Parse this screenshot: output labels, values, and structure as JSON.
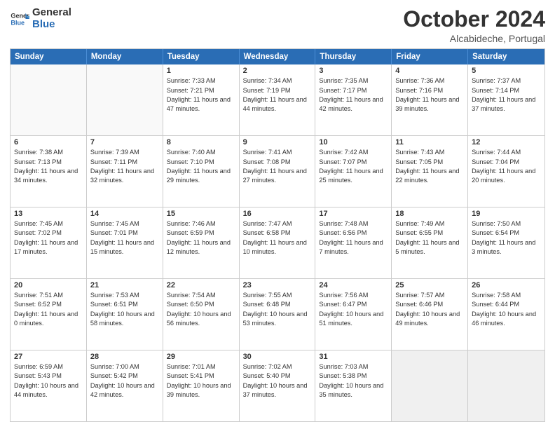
{
  "header": {
    "logo_general": "General",
    "logo_blue": "Blue",
    "month": "October 2024",
    "location": "Alcabideche, Portugal"
  },
  "days_of_week": [
    "Sunday",
    "Monday",
    "Tuesday",
    "Wednesday",
    "Thursday",
    "Friday",
    "Saturday"
  ],
  "rows": [
    [
      {
        "day": "",
        "empty": true
      },
      {
        "day": "",
        "empty": true
      },
      {
        "day": "1",
        "sunrise": "Sunrise: 7:33 AM",
        "sunset": "Sunset: 7:21 PM",
        "daylight": "Daylight: 11 hours and 47 minutes."
      },
      {
        "day": "2",
        "sunrise": "Sunrise: 7:34 AM",
        "sunset": "Sunset: 7:19 PM",
        "daylight": "Daylight: 11 hours and 44 minutes."
      },
      {
        "day": "3",
        "sunrise": "Sunrise: 7:35 AM",
        "sunset": "Sunset: 7:17 PM",
        "daylight": "Daylight: 11 hours and 42 minutes."
      },
      {
        "day": "4",
        "sunrise": "Sunrise: 7:36 AM",
        "sunset": "Sunset: 7:16 PM",
        "daylight": "Daylight: 11 hours and 39 minutes."
      },
      {
        "day": "5",
        "sunrise": "Sunrise: 7:37 AM",
        "sunset": "Sunset: 7:14 PM",
        "daylight": "Daylight: 11 hours and 37 minutes."
      }
    ],
    [
      {
        "day": "6",
        "sunrise": "Sunrise: 7:38 AM",
        "sunset": "Sunset: 7:13 PM",
        "daylight": "Daylight: 11 hours and 34 minutes."
      },
      {
        "day": "7",
        "sunrise": "Sunrise: 7:39 AM",
        "sunset": "Sunset: 7:11 PM",
        "daylight": "Daylight: 11 hours and 32 minutes."
      },
      {
        "day": "8",
        "sunrise": "Sunrise: 7:40 AM",
        "sunset": "Sunset: 7:10 PM",
        "daylight": "Daylight: 11 hours and 29 minutes."
      },
      {
        "day": "9",
        "sunrise": "Sunrise: 7:41 AM",
        "sunset": "Sunset: 7:08 PM",
        "daylight": "Daylight: 11 hours and 27 minutes."
      },
      {
        "day": "10",
        "sunrise": "Sunrise: 7:42 AM",
        "sunset": "Sunset: 7:07 PM",
        "daylight": "Daylight: 11 hours and 25 minutes."
      },
      {
        "day": "11",
        "sunrise": "Sunrise: 7:43 AM",
        "sunset": "Sunset: 7:05 PM",
        "daylight": "Daylight: 11 hours and 22 minutes."
      },
      {
        "day": "12",
        "sunrise": "Sunrise: 7:44 AM",
        "sunset": "Sunset: 7:04 PM",
        "daylight": "Daylight: 11 hours and 20 minutes."
      }
    ],
    [
      {
        "day": "13",
        "sunrise": "Sunrise: 7:45 AM",
        "sunset": "Sunset: 7:02 PM",
        "daylight": "Daylight: 11 hours and 17 minutes."
      },
      {
        "day": "14",
        "sunrise": "Sunrise: 7:45 AM",
        "sunset": "Sunset: 7:01 PM",
        "daylight": "Daylight: 11 hours and 15 minutes."
      },
      {
        "day": "15",
        "sunrise": "Sunrise: 7:46 AM",
        "sunset": "Sunset: 6:59 PM",
        "daylight": "Daylight: 11 hours and 12 minutes."
      },
      {
        "day": "16",
        "sunrise": "Sunrise: 7:47 AM",
        "sunset": "Sunset: 6:58 PM",
        "daylight": "Daylight: 11 hours and 10 minutes."
      },
      {
        "day": "17",
        "sunrise": "Sunrise: 7:48 AM",
        "sunset": "Sunset: 6:56 PM",
        "daylight": "Daylight: 11 hours and 7 minutes."
      },
      {
        "day": "18",
        "sunrise": "Sunrise: 7:49 AM",
        "sunset": "Sunset: 6:55 PM",
        "daylight": "Daylight: 11 hours and 5 minutes."
      },
      {
        "day": "19",
        "sunrise": "Sunrise: 7:50 AM",
        "sunset": "Sunset: 6:54 PM",
        "daylight": "Daylight: 11 hours and 3 minutes."
      }
    ],
    [
      {
        "day": "20",
        "sunrise": "Sunrise: 7:51 AM",
        "sunset": "Sunset: 6:52 PM",
        "daylight": "Daylight: 11 hours and 0 minutes."
      },
      {
        "day": "21",
        "sunrise": "Sunrise: 7:53 AM",
        "sunset": "Sunset: 6:51 PM",
        "daylight": "Daylight: 10 hours and 58 minutes."
      },
      {
        "day": "22",
        "sunrise": "Sunrise: 7:54 AM",
        "sunset": "Sunset: 6:50 PM",
        "daylight": "Daylight: 10 hours and 56 minutes."
      },
      {
        "day": "23",
        "sunrise": "Sunrise: 7:55 AM",
        "sunset": "Sunset: 6:48 PM",
        "daylight": "Daylight: 10 hours and 53 minutes."
      },
      {
        "day": "24",
        "sunrise": "Sunrise: 7:56 AM",
        "sunset": "Sunset: 6:47 PM",
        "daylight": "Daylight: 10 hours and 51 minutes."
      },
      {
        "day": "25",
        "sunrise": "Sunrise: 7:57 AM",
        "sunset": "Sunset: 6:46 PM",
        "daylight": "Daylight: 10 hours and 49 minutes."
      },
      {
        "day": "26",
        "sunrise": "Sunrise: 7:58 AM",
        "sunset": "Sunset: 6:44 PM",
        "daylight": "Daylight: 10 hours and 46 minutes."
      }
    ],
    [
      {
        "day": "27",
        "sunrise": "Sunrise: 6:59 AM",
        "sunset": "Sunset: 5:43 PM",
        "daylight": "Daylight: 10 hours and 44 minutes."
      },
      {
        "day": "28",
        "sunrise": "Sunrise: 7:00 AM",
        "sunset": "Sunset: 5:42 PM",
        "daylight": "Daylight: 10 hours and 42 minutes."
      },
      {
        "day": "29",
        "sunrise": "Sunrise: 7:01 AM",
        "sunset": "Sunset: 5:41 PM",
        "daylight": "Daylight: 10 hours and 39 minutes."
      },
      {
        "day": "30",
        "sunrise": "Sunrise: 7:02 AM",
        "sunset": "Sunset: 5:40 PM",
        "daylight": "Daylight: 10 hours and 37 minutes."
      },
      {
        "day": "31",
        "sunrise": "Sunrise: 7:03 AM",
        "sunset": "Sunset: 5:38 PM",
        "daylight": "Daylight: 10 hours and 35 minutes."
      },
      {
        "day": "",
        "empty": true
      },
      {
        "day": "",
        "empty": true
      }
    ]
  ]
}
